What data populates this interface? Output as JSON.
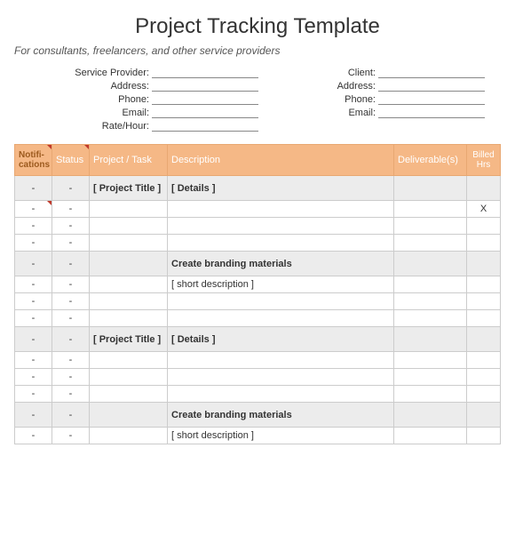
{
  "header": {
    "title": "Project Tracking Template",
    "subtitle": "For consultants, freelancers, and other service providers"
  },
  "provider_labels": [
    "Service Provider:",
    "Address:",
    "Phone:",
    "Email:",
    "Rate/Hour:"
  ],
  "client_labels": [
    "Client:",
    "Address:",
    "Phone:",
    "Email:"
  ],
  "columns": {
    "notifications": "Notifi-cations",
    "status": "Status",
    "project": "Project / Task",
    "description": "Description",
    "deliverables": "Deliverable(s)",
    "billed": "Billed Hrs"
  },
  "rows": [
    {
      "type": "group",
      "notif": "-",
      "status": "-",
      "project": "[ Project Title ]",
      "description": "[ Details ]",
      "deliv": "",
      "billed": ""
    },
    {
      "type": "item",
      "notif": "-",
      "status": "-",
      "project": "",
      "description": "",
      "deliv": "",
      "billed": "X"
    },
    {
      "type": "item",
      "notif": "-",
      "status": "-",
      "project": "",
      "description": "",
      "deliv": "",
      "billed": ""
    },
    {
      "type": "item",
      "notif": "-",
      "status": "-",
      "project": "",
      "description": "",
      "deliv": "",
      "billed": ""
    },
    {
      "type": "group",
      "notif": "-",
      "status": "-",
      "project": "",
      "description": "Create branding materials",
      "deliv": "",
      "billed": ""
    },
    {
      "type": "item",
      "notif": "-",
      "status": "-",
      "project": "",
      "description": "[ short description ]",
      "deliv": "",
      "billed": ""
    },
    {
      "type": "item",
      "notif": "-",
      "status": "-",
      "project": "",
      "description": "",
      "deliv": "",
      "billed": ""
    },
    {
      "type": "item",
      "notif": "-",
      "status": "-",
      "project": "",
      "description": "",
      "deliv": "",
      "billed": ""
    },
    {
      "type": "group",
      "notif": "-",
      "status": "-",
      "project": "[ Project Title ]",
      "description": "[ Details ]",
      "deliv": "",
      "billed": ""
    },
    {
      "type": "item",
      "notif": "-",
      "status": "-",
      "project": "",
      "description": "",
      "deliv": "",
      "billed": ""
    },
    {
      "type": "item",
      "notif": "-",
      "status": "-",
      "project": "",
      "description": "",
      "deliv": "",
      "billed": ""
    },
    {
      "type": "item",
      "notif": "-",
      "status": "-",
      "project": "",
      "description": "",
      "deliv": "",
      "billed": ""
    },
    {
      "type": "group",
      "notif": "-",
      "status": "-",
      "project": "",
      "description": "Create branding materials",
      "deliv": "",
      "billed": ""
    },
    {
      "type": "item",
      "notif": "-",
      "status": "-",
      "project": "",
      "description": "[ short description ]",
      "deliv": "",
      "billed": ""
    }
  ]
}
